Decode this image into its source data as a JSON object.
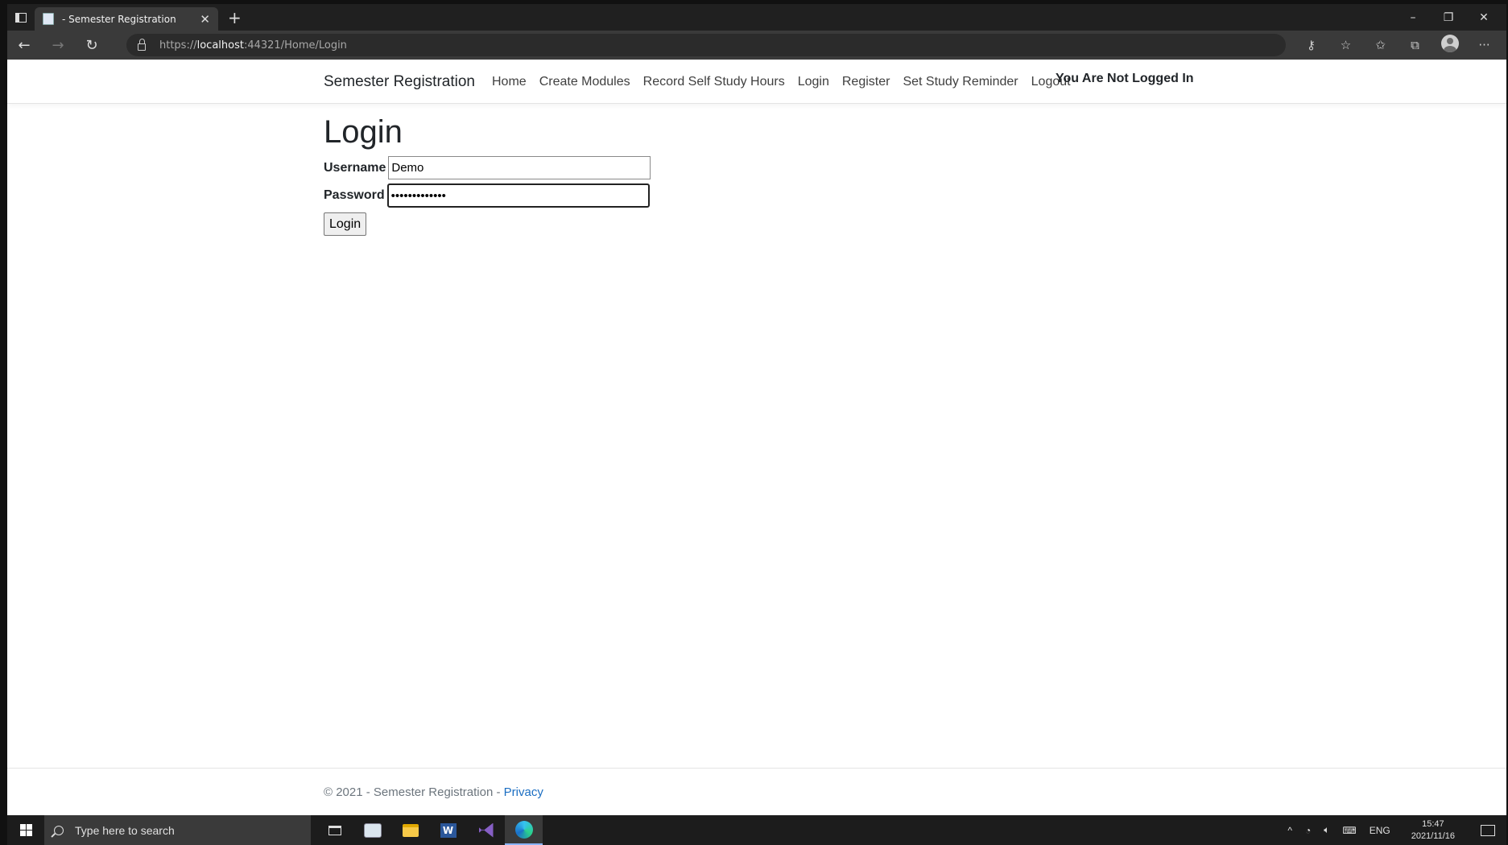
{
  "browser": {
    "tab_title": "- Semester Registration",
    "tab_close": "✕",
    "new_tab": "+",
    "url_scheme": "https://",
    "url_host": "localhost",
    "url_rest": ":44321/Home/Login",
    "window_controls": {
      "minimize": "–",
      "restore": "❐",
      "close": "✕"
    }
  },
  "navbar": {
    "brand": "Semester Registration",
    "links": [
      "Home",
      "Create Modules",
      "Record Self Study Hours",
      "Login",
      "Register",
      "Set Study Reminder",
      "Logout"
    ],
    "status": "You Are Not Logged In"
  },
  "login": {
    "title": "Login",
    "username_label": "Username",
    "username_value": "Demo",
    "password_label": "Password",
    "password_value": "•••••••••••••",
    "submit_label": "Login"
  },
  "footer": {
    "text": "© 2021 - Semester Registration - ",
    "privacy_link": "Privacy"
  },
  "taskbar": {
    "search_placeholder": "Type here to search",
    "word_letter": "W",
    "tray_chevron": "^",
    "language": "ENG",
    "time": "15:47",
    "date": "2021/11/16"
  }
}
